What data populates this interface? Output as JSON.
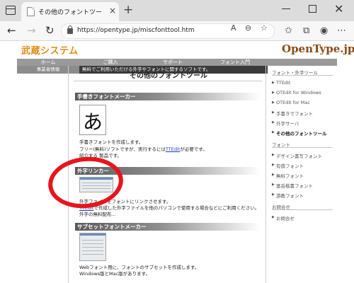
{
  "browser": {
    "tab_title": "その他のフォントツール | フォント・外字エ",
    "tab_close": "×",
    "new_tab": "+",
    "url": "https://opentype.jp/miscfonttool.htm"
  },
  "site": {
    "logo": "武蔵システム",
    "brand": "OpenType.jp",
    "menu": [
      "ホーム",
      "ご購入",
      "サポート",
      "フォント入門"
    ],
    "sub_left": "事業者情報",
    "sub_text": "無料でご利用いただける外字やフォントに関するソフトです。"
  },
  "main": {
    "title": "その他のフォントツール",
    "sections": [
      {
        "label": "手書きフォントメーカー",
        "lines": [
          "手書きフォントを作成します。",
          "フリー(無料)ソフトですが、実行するには",
          "TTEdit",
          "が必要です。",
          "紹介する  製品です。"
        ]
      },
      {
        "label": "外字リンカー",
        "lines": [
          "外字ファイルをフォントにリンクさせます。",
          "TTEdit",
          "で作成した外字ファイルを他のパソコンで使用する場合などにご利用ください。",
          "外字の無料配布..."
        ]
      },
      {
        "label": "サブセットフォントメーカー",
        "lines": [
          "Webフォント用に、フォントのサブセットを作成します。",
          "Windows版とMac版があります。"
        ]
      }
    ]
  },
  "sidebar": {
    "heading1": "フォント・外字ツール",
    "items1": [
      "TTEdit",
      "OTEdit for Windows",
      "OTEdit for Mac",
      "手書きでフォント",
      "外字サーバ",
      "その他のフォントツール"
    ],
    "heading2": "フォント",
    "items2": [
      "デザイン書写フォント",
      "有償フォント",
      "無料フォント",
      "富岳楷書フォント",
      "游教フォント"
    ],
    "heading3": "お問合せ",
    "items3": [
      "お問合せ"
    ]
  }
}
